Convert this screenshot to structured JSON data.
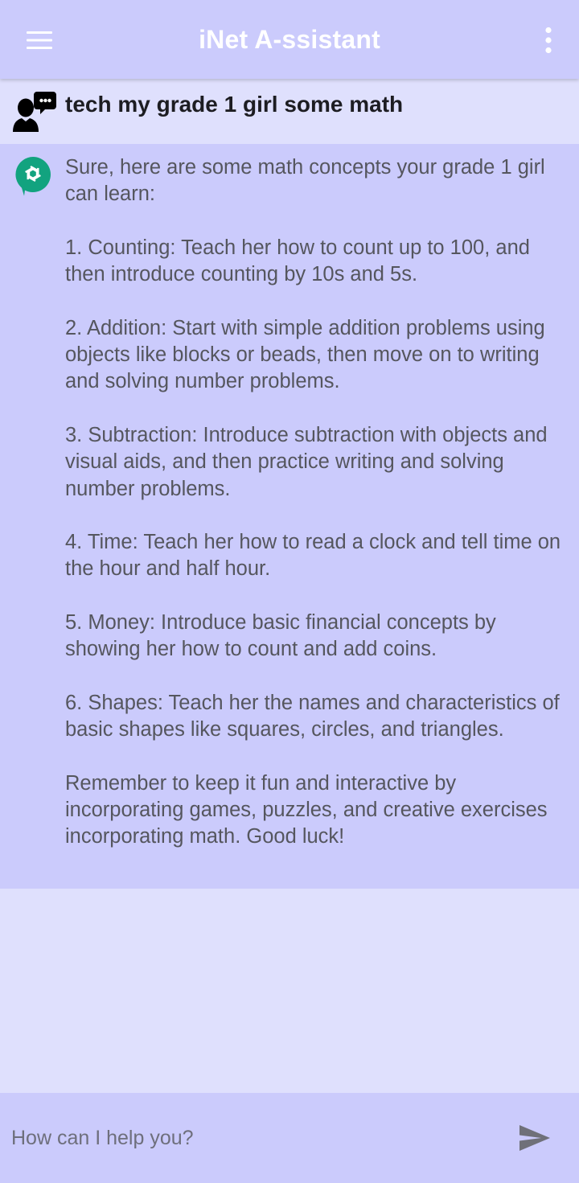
{
  "appbar": {
    "title": "iNet A-ssistant",
    "menu_icon": "hamburger-menu-icon",
    "more_icon": "more-vert-icon",
    "background": "#cbcbfc",
    "title_color": "#ffffff"
  },
  "conversation": {
    "user_message": {
      "icon": "user-chat-icon",
      "text": "tech my grade 1 girl some math"
    },
    "assistant_message": {
      "icon": "openai-logo-icon",
      "icon_color": "#12a37f",
      "text": "Sure, here are some math concepts your grade 1 girl can learn:\n\n1. Counting: Teach her how to count up to 100, and then introduce counting by 10s and 5s.\n\n2. Addition: Start with simple addition problems using objects like blocks or beads, then move on to writing and solving number problems.\n\n3. Subtraction: Introduce subtraction with objects and visual aids, and then practice writing and solving number problems.\n\n4. Time: Teach her how to read a clock and tell time on the hour and half hour.\n\n5. Money: Introduce basic financial concepts by showing her how to count and add coins.\n\n6. Shapes: Teach her the names and characteristics of basic shapes like squares, circles, and triangles.\n\nRemember to keep it fun and interactive by incorporating games, puzzles, and creative exercises incorporating math. Good luck!"
    }
  },
  "input": {
    "placeholder": "How can I help you?",
    "value": "",
    "send_icon": "send-icon"
  },
  "colors": {
    "page_background": "#dfe0fd",
    "assistant_background": "#cbcbfc",
    "assistant_text": "#55565e",
    "icon_grey": "#6f7079"
  }
}
